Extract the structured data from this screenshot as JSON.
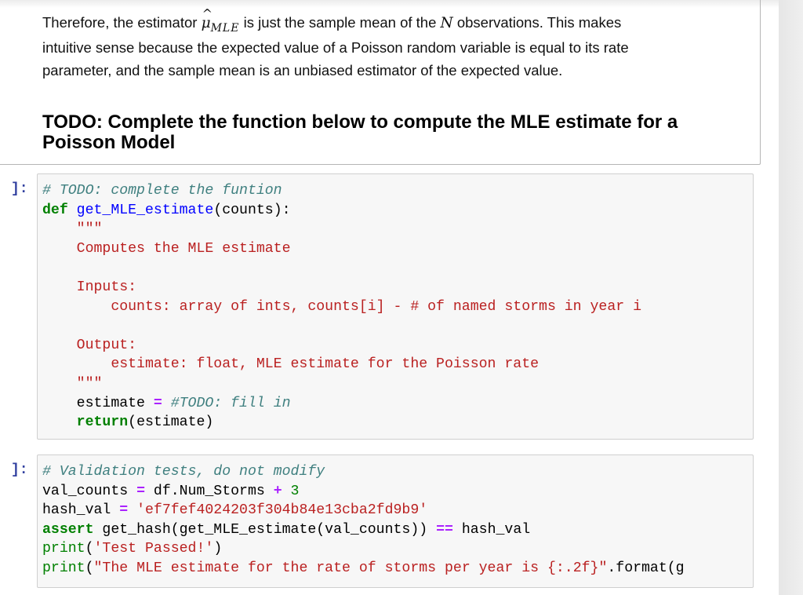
{
  "markdown_cell": {
    "paragraph": {
      "text_before_math": "Therefore, the estimator ",
      "estimator_symbol": "μ",
      "estimator_hat": "^",
      "estimator_subscript": "MLE",
      "text_after_math": " is just the sample mean of the ",
      "n_symbol": "N",
      "text_end_line1": " observations. This makes",
      "line2": "intuitive sense because the expected value of a Poisson random variable is equal to its rate",
      "line3": "parameter, and the sample mean is an unbiased estimator of the expected value."
    },
    "heading": "TODO: Complete the function below to compute the MLE estimate for a Poisson Model"
  },
  "code_cells": [
    {
      "prompt": "]:",
      "lines": {
        "l1_comment": "# TODO: complete the funtion",
        "l2_def": "def",
        "l2_fn": "get_MLE_estimate",
        "l2_rest": "(counts):",
        "l3_docstart": "    \"\"\"",
        "l4": "    Computes the MLE estimate",
        "l5": "",
        "l6": "    Inputs:",
        "l7": "        counts: array of ints, counts[i] - # of named storms in year i",
        "l8": "",
        "l9": "    Output:",
        "l10": "        estimate: float, MLE estimate for the Poisson rate",
        "l11_docend": "    \"\"\"",
        "l12_var": "    estimate ",
        "l12_op": "=",
        "l12_comment": " #TODO: fill in",
        "l13_indent": "    ",
        "l13_kw": "return",
        "l13_rest": "(estimate)"
      }
    },
    {
      "prompt": "]:",
      "lines": {
        "l1_comment": "# Validation tests, do not modify",
        "l2_a": "val_counts ",
        "l2_op": "=",
        "l2_b": " df.Num_Storms ",
        "l2_op2": "+",
        "l2_num": " 3",
        "l3_a": "hash_val ",
        "l3_op": "=",
        "l3_str": " 'ef7fef4024203f304b84e13cba2fd9b9'",
        "l4_kw": "assert",
        "l4_a": " get_hash(get_MLE_estimate(val_counts)) ",
        "l4_op": "==",
        "l4_b": " hash_val",
        "l5_fn": "print",
        "l5_a": "(",
        "l5_str": "'Test Passed!'",
        "l5_b": ")",
        "l6_fn": "print",
        "l6_a": "(",
        "l6_str": "\"The MLE estimate for the rate of storms per year is {:.2f}\"",
        "l6_b": ".format(g"
      }
    }
  ],
  "colors": {
    "prompt": "#303f9f",
    "comment": "#408080",
    "keyword": "#008000",
    "function_name": "#0000ff",
    "string": "#ba2121",
    "operator": "#aa22ff",
    "cell_background": "#f7f7f7"
  }
}
